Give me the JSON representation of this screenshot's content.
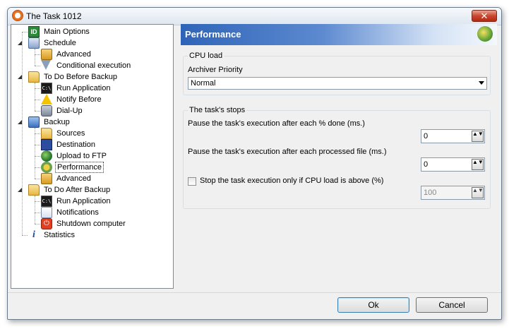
{
  "window": {
    "title": "The Task 1012",
    "close_label": "✕"
  },
  "tree": {
    "items": [
      {
        "label": "Main Options",
        "icon": "id-icon"
      },
      {
        "label": "Schedule",
        "icon": "schedule-icon"
      },
      {
        "label": "Advanced",
        "icon": "advanced-icon"
      },
      {
        "label": "Conditional execution",
        "icon": "filter-icon"
      },
      {
        "label": "To Do Before Backup",
        "icon": "folder-icon"
      },
      {
        "label": "Run Application",
        "icon": "command-icon"
      },
      {
        "label": "Notify Before",
        "icon": "warning-icon"
      },
      {
        "label": "Dial-Up",
        "icon": "dialup-icon"
      },
      {
        "label": "Backup",
        "icon": "backup-icon"
      },
      {
        "label": "Sources",
        "icon": "folder-icon"
      },
      {
        "label": "Destination",
        "icon": "floppy-icon"
      },
      {
        "label": "Upload to FTP",
        "icon": "globe-icon"
      },
      {
        "label": "Performance",
        "icon": "performance-icon",
        "selected": true
      },
      {
        "label": "Advanced",
        "icon": "advanced-icon"
      },
      {
        "label": "To Do After Backup",
        "icon": "folder-icon"
      },
      {
        "label": "Run Application",
        "icon": "command-icon"
      },
      {
        "label": "Notifications",
        "icon": "mail-icon"
      },
      {
        "label": "Shutdown computer",
        "icon": "power-icon"
      },
      {
        "label": "Statistics",
        "icon": "info-icon"
      }
    ],
    "icon_text": {
      "id": "ID",
      "cmd": "C:\\",
      "info": "i",
      "power": "⏻"
    },
    "expander_glyph": "◢"
  },
  "panel": {
    "title": "Performance",
    "cpu_group": {
      "legend": "CPU load",
      "priority_label": "Archiver Priority",
      "priority_value": "Normal"
    },
    "stops_group": {
      "legend": "The task's stops",
      "pause_percent_label": "Pause the task's execution after each % done (ms.)",
      "pause_percent_value": "0",
      "pause_file_label": "Pause the task's execution after each processed file (ms.)",
      "pause_file_value": "0",
      "cpu_stop_label": "Stop the task execution only if CPU load is above (%)",
      "cpu_stop_checked": false,
      "cpu_stop_value": "100"
    },
    "spin_glyph": "▲▼"
  },
  "buttons": {
    "ok": "Ok",
    "cancel": "Cancel"
  },
  "colors": {
    "header_start": "#2e64b8",
    "header_end": "#f4f8fd",
    "accent_border": "#3c7fb1"
  }
}
